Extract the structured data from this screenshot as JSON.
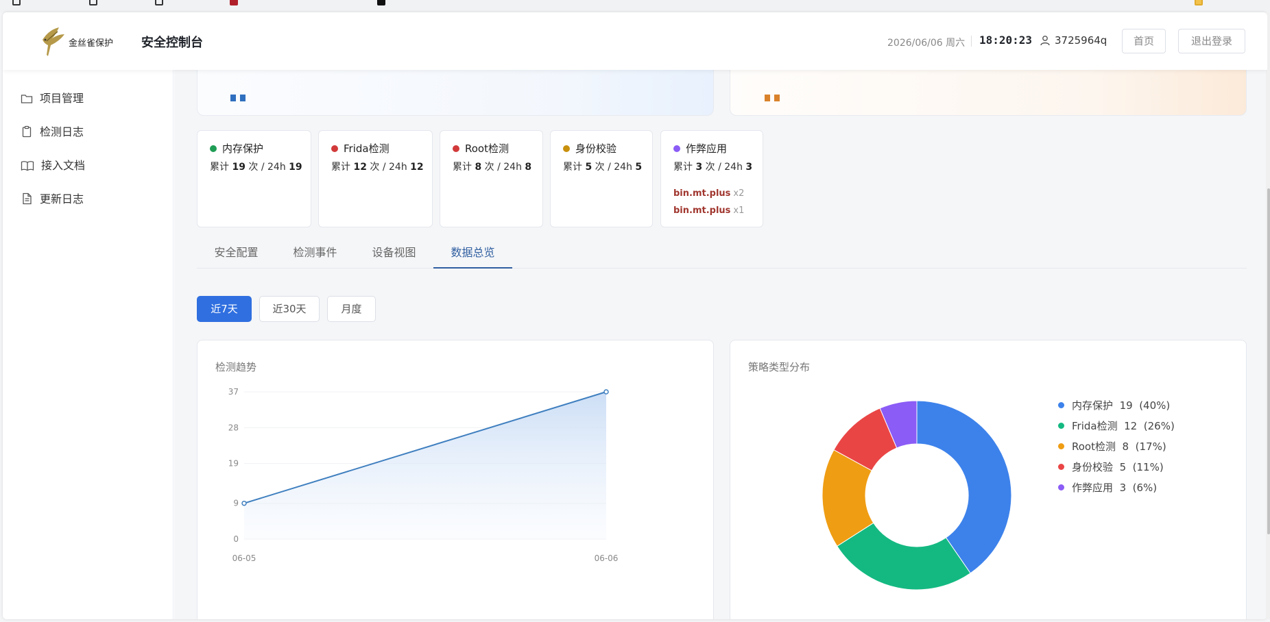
{
  "header": {
    "logo_text": "金丝雀保护",
    "title": "安全控制台",
    "date": "2026/06/06 周六",
    "time": "18:20:23",
    "user": "3725964q",
    "home_label": "首页",
    "logout_label": "退出登录"
  },
  "sidebar": {
    "items": [
      {
        "label": "项目管理",
        "icon": "folder-icon"
      },
      {
        "label": "检测日志",
        "icon": "clipboard-icon"
      },
      {
        "label": "接入文档",
        "icon": "book-icon"
      },
      {
        "label": "更新日志",
        "icon": "document-icon"
      }
    ]
  },
  "stats": [
    {
      "name": "内存保护",
      "color": "#1f9d55",
      "prefix": "累计",
      "total": "19",
      "mid": "次 / 24h",
      "day": "19"
    },
    {
      "name": "Frida检测",
      "color": "#d23a3a",
      "prefix": "累计",
      "total": "12",
      "mid": "次 / 24h",
      "day": "12"
    },
    {
      "name": "Root检测",
      "color": "#d23a3a",
      "prefix": "累计",
      "total": "8",
      "mid": "次 / 24h",
      "day": "8"
    },
    {
      "name": "身份校验",
      "color": "#c9900e",
      "prefix": "累计",
      "total": "5",
      "mid": "次 / 24h",
      "day": "5"
    },
    {
      "name": "作弊应用",
      "color": "#8b5cf6",
      "prefix": "累计",
      "total": "3",
      "mid": "次 / 24h",
      "day": "3",
      "apps": [
        {
          "pkg": "bin.mt.plus",
          "count": "x2"
        },
        {
          "pkg": "bin.mt.plus",
          "count": "x1"
        }
      ]
    }
  ],
  "tabs": [
    {
      "label": "安全配置",
      "active": false
    },
    {
      "label": "检测事件",
      "active": false
    },
    {
      "label": "设备视图",
      "active": false
    },
    {
      "label": "数据总览",
      "active": true
    }
  ],
  "ranges": [
    {
      "label": "近7天",
      "active": true
    },
    {
      "label": "近30天",
      "active": false
    },
    {
      "label": "月度",
      "active": false
    }
  ],
  "colors": {
    "primary": "#2f6fe0",
    "line": "#3f7fbf"
  },
  "chart_data": [
    {
      "type": "area",
      "title": "检测趋势",
      "x": [
        "06-05",
        "06-06"
      ],
      "series": [
        {
          "values": [
            9,
            37
          ]
        }
      ],
      "yticks": [
        0,
        9,
        19,
        28,
        37
      ],
      "ylim": [
        0,
        37
      ],
      "grid": true
    },
    {
      "type": "pie",
      "title": "策略类型分布",
      "donut": true,
      "legend": "right",
      "slices": [
        {
          "name": "内存保护",
          "value": 19,
          "pct": "(40%)",
          "color": "#3d82eb"
        },
        {
          "name": "Frida检测",
          "value": 12,
          "pct": "(26%)",
          "color": "#14b981"
        },
        {
          "name": "Root检测",
          "value": 8,
          "pct": "(17%)",
          "color": "#ef9d13"
        },
        {
          "name": "身份校验",
          "value": 5,
          "pct": "(11%)",
          "color": "#ea4545"
        },
        {
          "name": "作弊应用",
          "value": 3,
          "pct": "(6%)",
          "color": "#8b5cf6"
        }
      ]
    }
  ]
}
